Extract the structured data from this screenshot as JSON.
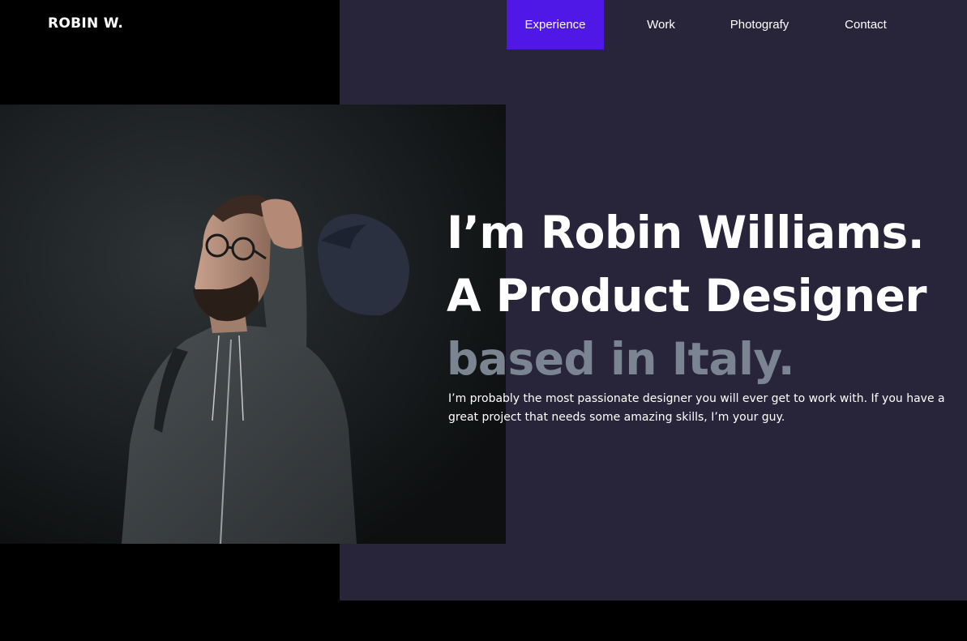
{
  "header": {
    "logo": "ROBIN W.",
    "nav": [
      {
        "label": "Experience",
        "active": true
      },
      {
        "label": "Work",
        "active": false
      },
      {
        "label": "Photografy",
        "active": false
      },
      {
        "label": "Contact",
        "active": false
      }
    ]
  },
  "hero": {
    "line1": "I’m Robin Williams.",
    "line2": "A Product Designer",
    "line3": "based in Italy.",
    "intro": "I’m probably the most passionate designer you will ever get to work with. If you have a great project that needs some amazing skills, I’m your guy."
  },
  "colors": {
    "background": "#000000",
    "panel": "#28253a",
    "nav_active": "#5018e6",
    "accent_text": "#7b8592",
    "text": "#ffffff"
  }
}
